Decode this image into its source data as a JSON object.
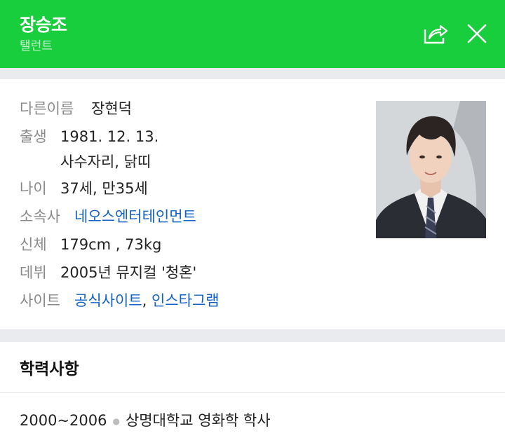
{
  "header": {
    "name": "장승조",
    "occupation": "탤런트",
    "share_icon": "share-icon",
    "close_icon": "close-icon"
  },
  "profile": {
    "alias": {
      "label": "다른이름",
      "value": "장현덕"
    },
    "birth": {
      "label": "출생",
      "date": "1981. 12. 13.",
      "signs": "사수자리, 닭띠"
    },
    "age": {
      "label": "나이",
      "value": "37세, 만35세"
    },
    "agency": {
      "label": "소속사",
      "value": "네오스엔터테인먼트"
    },
    "body": {
      "label": "신체",
      "value": "179cm , 73kg"
    },
    "debut": {
      "label": "데뷔",
      "value": "2005년 뮤지컬 '청혼'"
    },
    "sites": {
      "label": "사이트",
      "official": "공식사이트",
      "separator": ",",
      "instagram": "인스타그램"
    }
  },
  "education": {
    "title": "학력사항",
    "items": [
      {
        "period": "2000~2006",
        "school": "상명대학교 영화학 학사"
      }
    ]
  },
  "colors": {
    "brand_green": "#19ce3c",
    "link_blue": "#1362c2",
    "label_gray": "#8a8a8a"
  }
}
